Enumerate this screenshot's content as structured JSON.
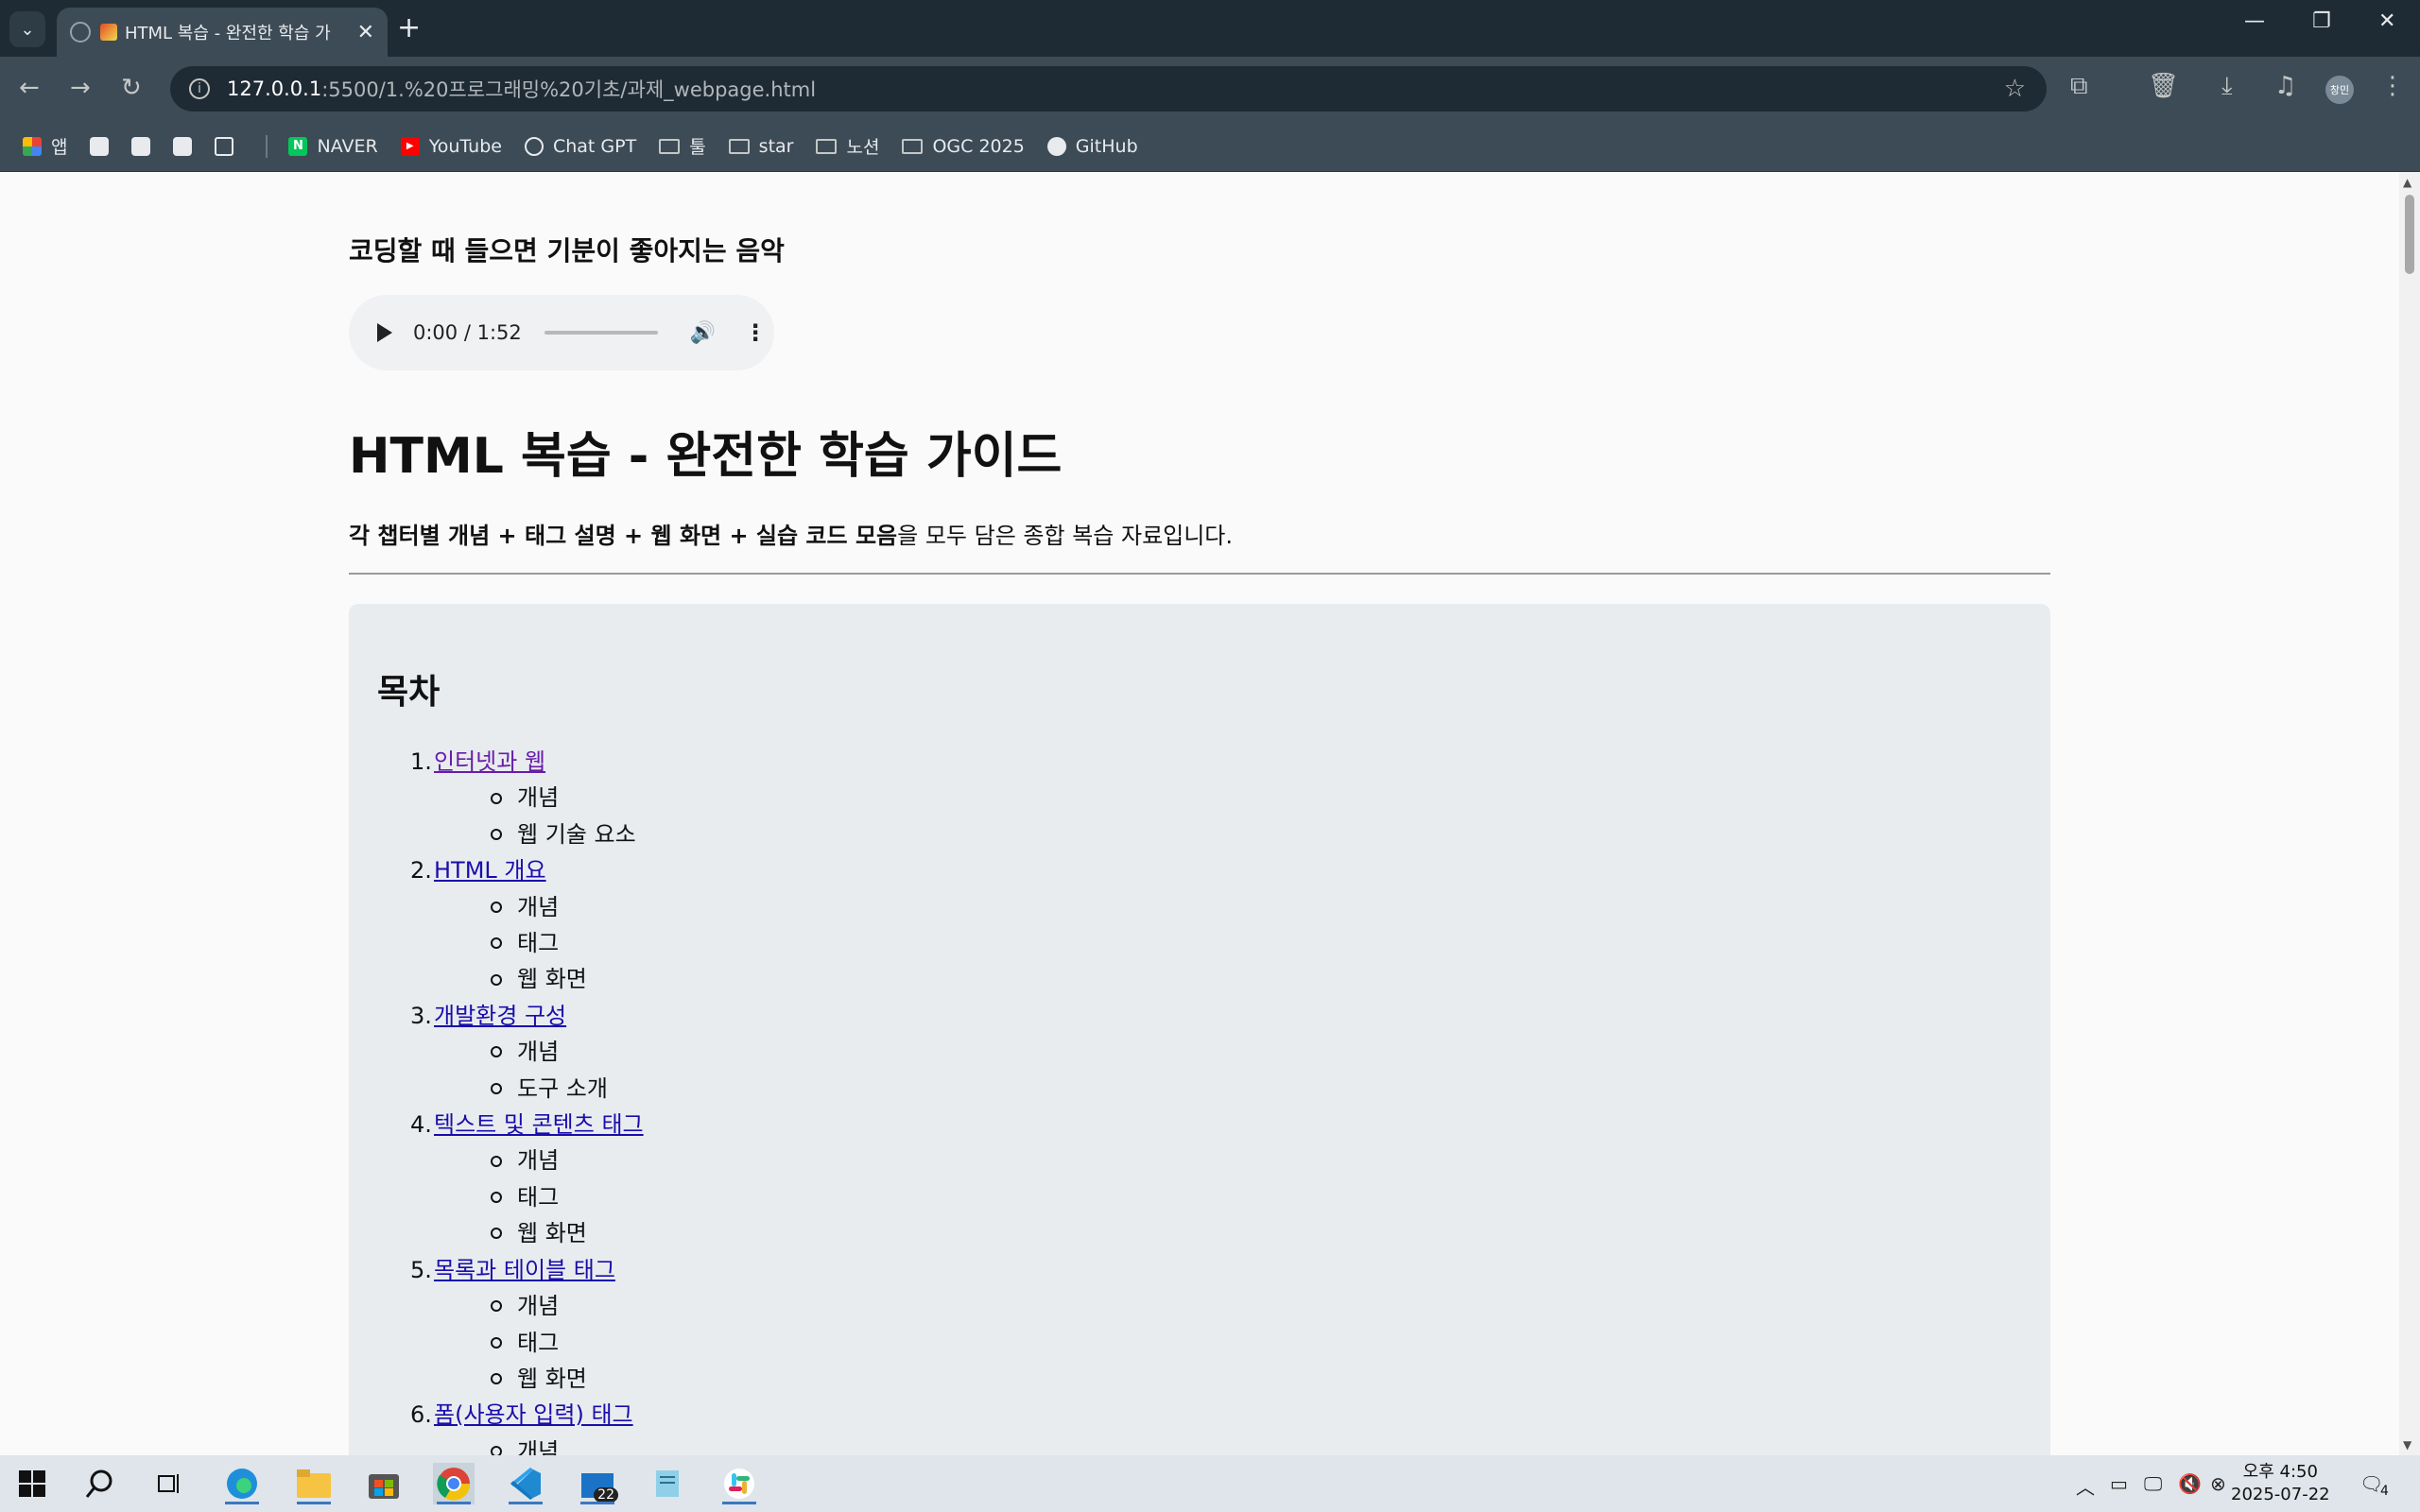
{
  "browser": {
    "tab_title": "HTML 복습 - 완전한 학습 가",
    "url_host": "127.0.0.1",
    "url_path": ":5500/1.%20프로그래밍%20기초/과제_webpage.html",
    "profile_label": "창민"
  },
  "bookmarks": {
    "apps_label": "앱",
    "items": [
      "NAVER",
      "YouTube",
      "Chat GPT",
      "툴",
      "star",
      "노션",
      "OGC 2025",
      "GitHub"
    ]
  },
  "page": {
    "music_title": "코딩할 때 들으면 기분이 좋아지는 음악",
    "audio_time": "0:00 / 1:52",
    "heading": "HTML 복습 - 완전한 학습 가이드",
    "intro_bold": "각 챕터별 개념 + 태그 설명 + 웹 화면 + 실습 코드 모음",
    "intro_rest": "을 모두 담은 종합 복습 자료입니다.",
    "toc_title": "목차",
    "toc": [
      {
        "num": "1.",
        "label": "인터넷과 웹",
        "subs": [
          "개념",
          "웹 기술 요소"
        ]
      },
      {
        "num": "2.",
        "label": "HTML 개요",
        "subs": [
          "개념",
          "태그",
          "웹 화면"
        ]
      },
      {
        "num": "3.",
        "label": "개발환경 구성",
        "subs": [
          "개념",
          "도구 소개"
        ]
      },
      {
        "num": "4.",
        "label": "텍스트 및 콘텐츠 태그",
        "subs": [
          "개념",
          "태그",
          "웹 화면"
        ]
      },
      {
        "num": "5.",
        "label": "목록과 테이블 태그",
        "subs": [
          "개념",
          "태그",
          "웹 화면"
        ]
      },
      {
        "num": "6.",
        "label": "폼(사용자 입력) 태그",
        "subs": [
          "개념"
        ]
      }
    ]
  },
  "taskbar": {
    "mail_badge": "22",
    "time": "오후 4:50",
    "date": "2025-07-22",
    "notification_count": "4"
  }
}
